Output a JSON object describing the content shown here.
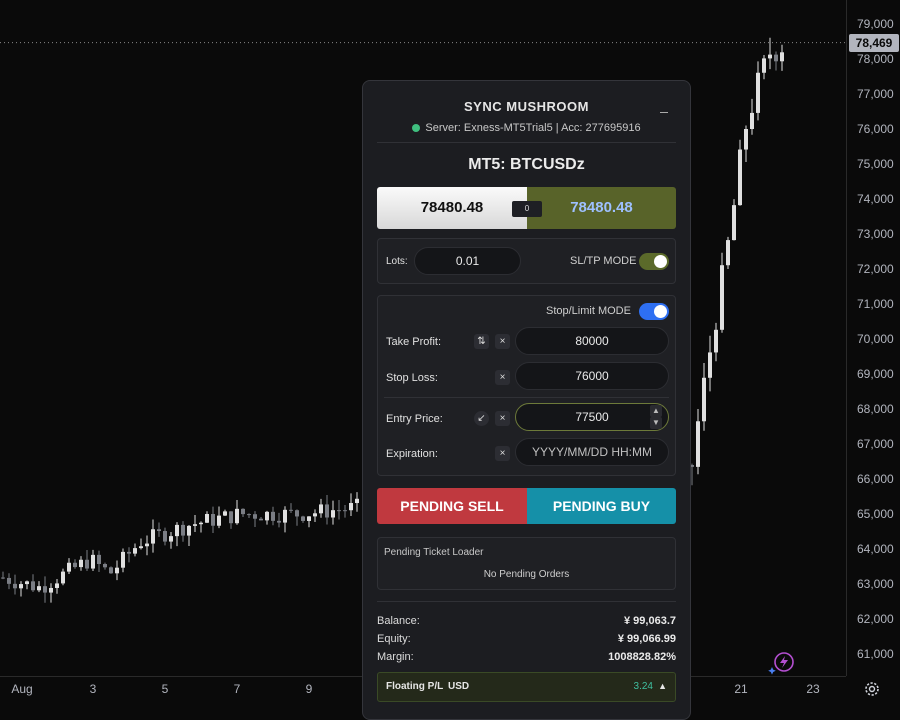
{
  "chart_data": {
    "type": "candlestick",
    "price_ticks": [
      "79,000",
      "78,000",
      "77,000",
      "76,000",
      "75,000",
      "74,000",
      "73,000",
      "72,000",
      "71,000",
      "70,000",
      "69,000",
      "68,000",
      "67,000",
      "66,000",
      "65,000",
      "64,000",
      "63,000",
      "62,000",
      "61,000"
    ],
    "current_price": "78,469",
    "time_ticks": [
      "Aug",
      "3",
      "5",
      "7",
      "9",
      "21",
      "23"
    ],
    "ylim": [
      60600,
      79650
    ],
    "up_color": "#e0e0e0",
    "down_color": "#7a7d84"
  },
  "panel": {
    "title": "SYNC MUSHROOM",
    "server_status": "Server: Exness-MT5Trial5 | Acc: 277695916",
    "symbol": "MT5: BTCUSDz",
    "bid": "78480.48",
    "ask": "78480.48",
    "spread": "0",
    "lots_label": "Lots:",
    "lots_value": "0.01",
    "sltp_mode_label": "SL/TP MODE",
    "stop_limit_label": "Stop/Limit MODE",
    "take_profit_label": "Take Profit:",
    "take_profit_value": "80000",
    "stop_loss_label": "Stop Loss:",
    "stop_loss_value": "76000",
    "entry_price_label": "Entry Price:",
    "entry_price_value": "77500",
    "expiration_label": "Expiration:",
    "expiration_placeholder": "YYYY/MM/DD HH:MM",
    "sell_label": "PENDING SELL",
    "buy_label": "PENDING BUY",
    "loader_title": "Pending Ticket Loader",
    "loader_message": "No Pending Orders",
    "balance_label": "Balance:",
    "balance_value": "¥ 99,063.7",
    "equity_label": "Equity:",
    "equity_value": "¥ 99,066.99",
    "margin_label": "Margin:",
    "margin_value": "1008828.82%",
    "floating_label": "Floating P/L",
    "floating_currency": "USD",
    "floating_value": "3.24",
    "sltp_on": true,
    "stop_limit_on": true
  },
  "colors": {
    "sell": "#c0393f",
    "buy": "#1590a8",
    "ask_bg": "#586329",
    "connected": "#3fbf7f"
  }
}
